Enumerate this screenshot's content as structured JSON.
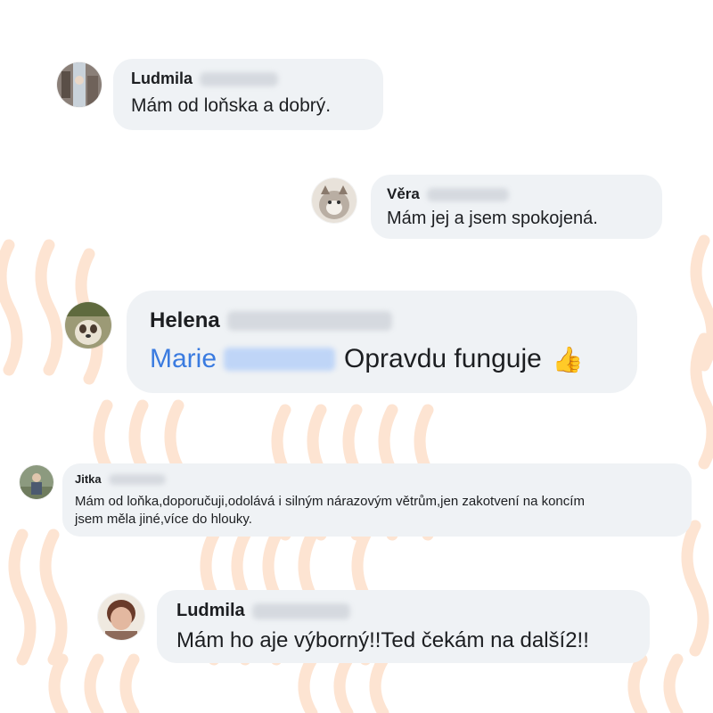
{
  "comments": [
    {
      "author_first": "Ludmila",
      "text": "Mám od loňska a dobrý."
    },
    {
      "author_first": "Věra",
      "text": "Mám jej a jsem spokojená."
    },
    {
      "author_first": "Helena",
      "mention_first": "Marie",
      "text": "Opravdu funguje",
      "emoji": "👍"
    },
    {
      "author_first": "Jitka",
      "text_line1": "Mám od loňka,doporučuji,odolává i silným nárazovým větrům,jen zakotvení na koncím",
      "text_line2": "jsem měla jiné,více do hlouky."
    },
    {
      "author_first": "Ludmila",
      "text": "Mám ho aje výborný!!Ted čekám na další2!!"
    }
  ],
  "colors": {
    "bubble": "#eff2f5",
    "text": "#1c1e21",
    "mention": "#3a7be0",
    "background_waves": "#fde4d2"
  },
  "icons": [
    "avatar-photo",
    "thumbs-up-emoji"
  ]
}
